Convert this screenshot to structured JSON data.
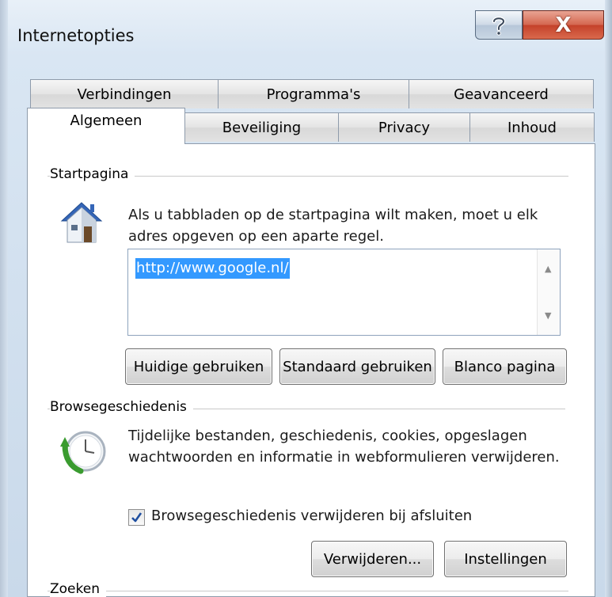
{
  "window": {
    "title": "Internetopties",
    "help_label": "?",
    "close_label": "X"
  },
  "tabs": {
    "row_back": [
      "Verbindingen",
      "Programma's",
      "Geavanceerd"
    ],
    "row_front": [
      "Algemeen",
      "Beveiliging",
      "Privacy",
      "Inhoud"
    ],
    "active": "Algemeen"
  },
  "startpagina": {
    "group_label": "Startpagina",
    "description_line1": "Als u tabbladen op de startpagina wilt maken, moet u elk",
    "description_line2": "adres opgeven op een aparte regel.",
    "value": "http://www.google.nl/",
    "buttons": {
      "current": "Huidige gebruiken",
      "default": "Standaard gebruiken",
      "blank": "Blanco pagina"
    }
  },
  "browsegeschiedenis": {
    "group_label": "Browsegeschiedenis",
    "description_line1": "Tijdelijke bestanden, geschiedenis, cookies, opgeslagen",
    "description_line2": "wachtwoorden en informatie in webformulieren verwijderen.",
    "checkbox_label": "Browsegeschiedenis verwijderen bij afsluiten",
    "checkbox_checked": true,
    "buttons": {
      "delete": "Verwijderen...",
      "settings": "Instellingen"
    }
  },
  "zoeken": {
    "group_label": "Zoeken"
  },
  "colors": {
    "selection": "#3399ff",
    "close_button": "#c4412a"
  },
  "icons": {
    "home": "house-icon",
    "history": "clock-history-icon"
  }
}
